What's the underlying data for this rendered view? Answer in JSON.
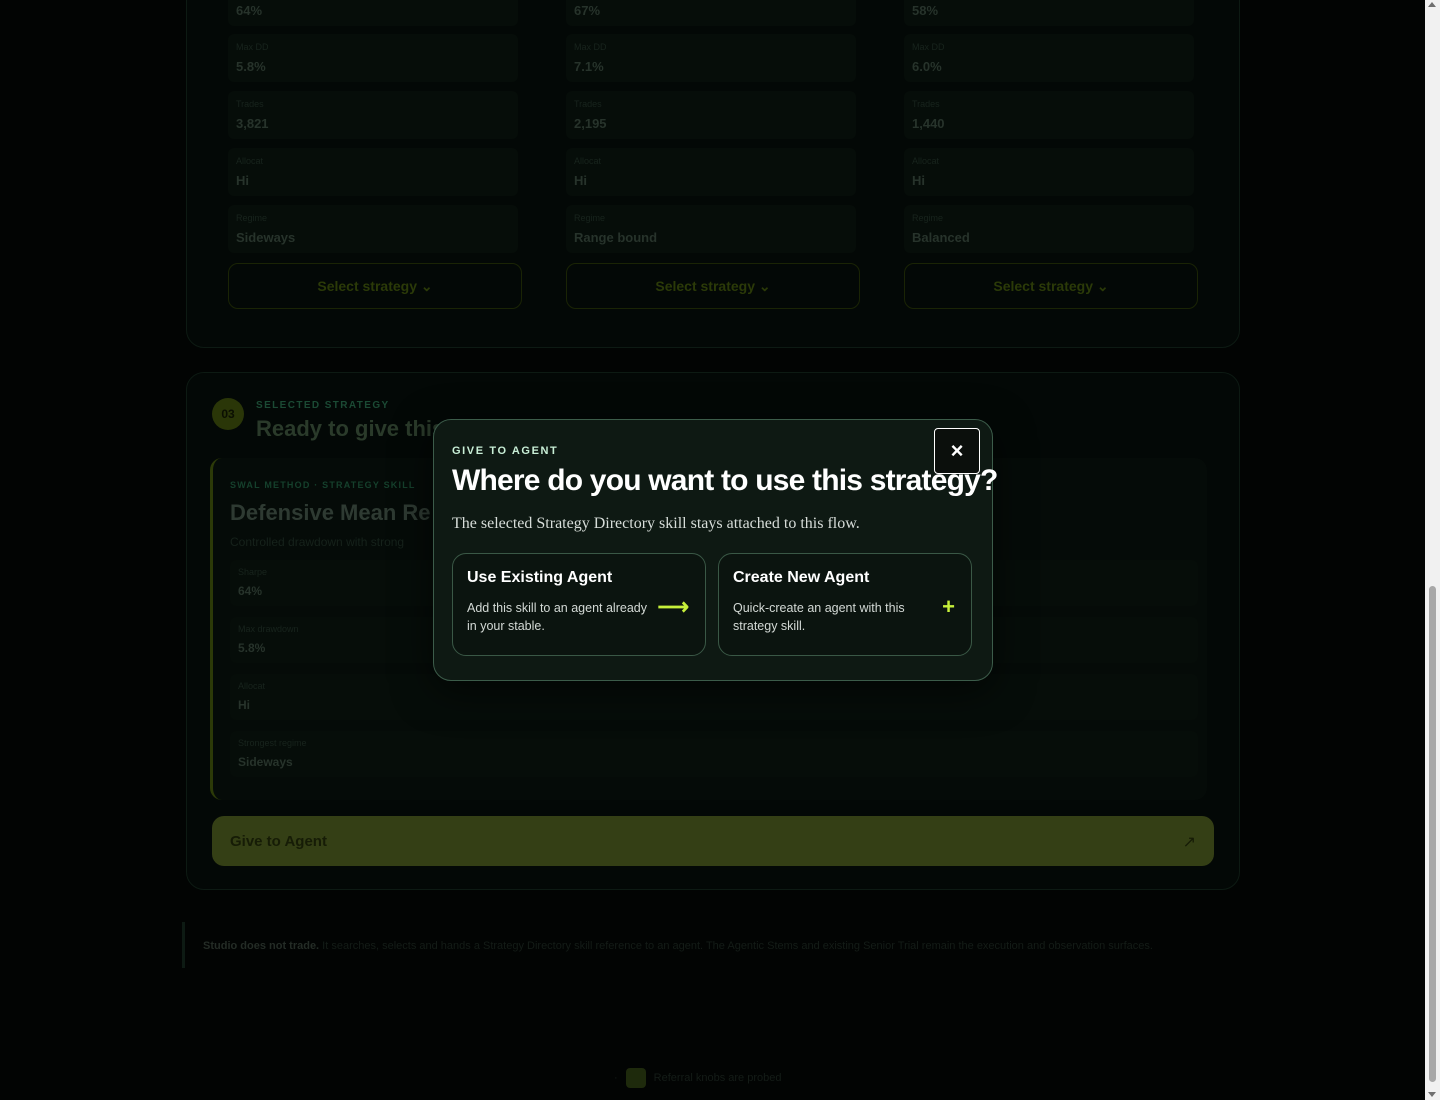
{
  "strategies": [
    {
      "win_rate": "64%",
      "max_dd": "5.8%",
      "trades": "3,821",
      "alloc": "Hi",
      "regime": "Sideways",
      "select_label": "Select strategy"
    },
    {
      "win_rate": "67%",
      "max_dd": "7.1%",
      "trades": "2,195",
      "alloc": "Hi",
      "regime": "Range bound",
      "select_label": "Select strategy"
    },
    {
      "win_rate": "58%",
      "max_dd": "6.0%",
      "trades": "1,440",
      "alloc": "Hi",
      "regime": "Balanced",
      "select_label": "Select strategy"
    }
  ],
  "metric_labels": {
    "max_dd": "Max DD",
    "trades": "Trades",
    "alloc": "Allocat",
    "regime": "Regime"
  },
  "selected": {
    "step": "03",
    "kicker": "SELECTED STRATEGY",
    "title": "Ready to give this s",
    "card_kicker": "SWAL METHOD · STRATEGY SKILL",
    "card_title": "Defensive Mean Re",
    "card_sub": "Controlled drawdown with strong",
    "metrics": [
      {
        "label": "Sharpe",
        "value": "64%"
      },
      {
        "label": "Max drawdown",
        "value": "5.8%"
      },
      {
        "label": "Allocat",
        "value": "Hi"
      },
      {
        "label": "Strongest regime",
        "value": "Sideways"
      }
    ],
    "give_label": "Give to Agent",
    "give_icon": "↗"
  },
  "note": {
    "bold": "Studio does not trade.",
    "text": " It searches, selects and hands a Strategy Directory skill reference to an agent. The Agentic Stems and existing Senior Trial remain the execution and observation surfaces."
  },
  "footer": {
    "text": "Referral knobs are probed"
  },
  "modal": {
    "kicker": "GIVE TO AGENT",
    "title": "Where do you want to use this strategy?",
    "description": "The selected Strategy Directory skill stays attached to this flow.",
    "close_icon": "×",
    "options": [
      {
        "title": "Use Existing Agent",
        "description": "Add this skill to an agent already in your stable.",
        "icon": "⟶"
      },
      {
        "title": "Create New Agent",
        "description": "Quick-create an agent with this strategy skill.",
        "icon": "+"
      }
    ]
  },
  "colors": {
    "accent": "#c6f03a",
    "modal_bg": "#0e1913",
    "page_bg": "#020403"
  }
}
